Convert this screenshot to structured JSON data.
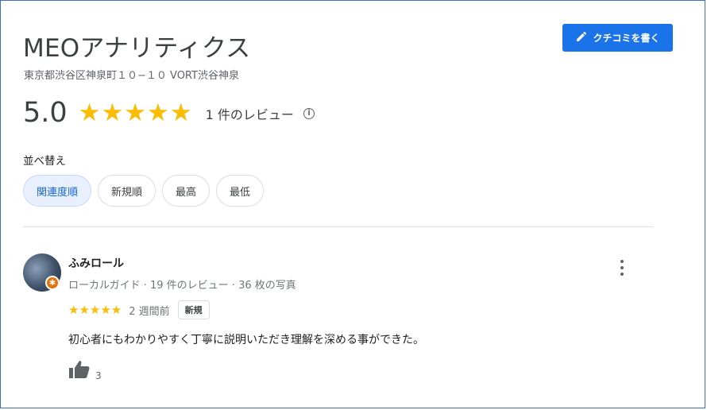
{
  "place": {
    "title": "MEOアナリティクス",
    "address": "東京都渋谷区神泉町１０−１０ VORT渋谷神泉"
  },
  "actions": {
    "write_review_label": "クチコミを書く"
  },
  "summary": {
    "rating": "5.0",
    "stars": "★★★★★",
    "review_count": "1 件のレビュー",
    "info_icon": "i"
  },
  "sort": {
    "label": "並べ替え",
    "options": [
      "関連度順",
      "新規順",
      "最高",
      "最低"
    ],
    "selected": "関連度順"
  },
  "review": {
    "author": "ふみロール",
    "meta": "ローカルガイド · 19 件のレビュー · 36 枚の写真",
    "stars": "★★★★★",
    "time_ago": "2 週間前",
    "new_badge": "新規",
    "text": "初心者にもわかりやすく丁寧に説明いただき理解を深める事ができた。",
    "likes": "3"
  },
  "colors": {
    "accent": "#1a73e8",
    "star": "#fbbc04",
    "badge": "#e8710a"
  }
}
